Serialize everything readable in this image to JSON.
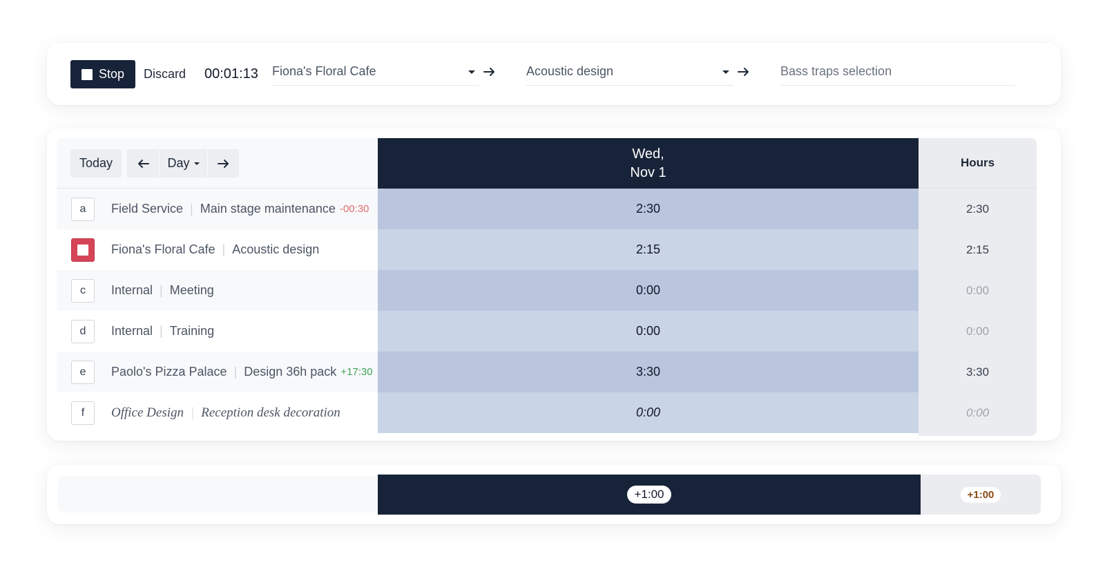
{
  "timer": {
    "stop_label": "Stop",
    "discard_label": "Discard",
    "elapsed": "00:01:13",
    "client": "Fiona's Floral Cafe",
    "project": "Acoustic design",
    "task_placeholder": "Bass traps selection"
  },
  "nav": {
    "today_label": "Today",
    "view_label": "Day"
  },
  "day_header": {
    "line1": "Wed,",
    "line2": "Nov 1"
  },
  "hours_header": "Hours",
  "rows": [
    {
      "key": "a",
      "client": "Field Service",
      "project": "Main stage maintenance",
      "badge": "-00:30",
      "day_value": "2:30",
      "total": "2:30"
    },
    {
      "key": "",
      "client": "Fiona's Floral Cafe",
      "project": "Acoustic design",
      "badge": "",
      "day_value": "2:15",
      "total": "2:15"
    },
    {
      "key": "c",
      "client": "Internal",
      "project": "Meeting",
      "badge": "",
      "day_value": "0:00",
      "total": "0:00"
    },
    {
      "key": "d",
      "client": "Internal",
      "project": "Training",
      "badge": "",
      "day_value": "0:00",
      "total": "0:00"
    },
    {
      "key": "e",
      "client": "Paolo's Pizza Palace",
      "project": "Design 36h pack",
      "badge": "+17:30",
      "day_value": "3:30",
      "total": "3:30"
    },
    {
      "key": "f",
      "client": "Office Design",
      "project": "Reception desk decoration",
      "badge": "",
      "day_value": "0:00",
      "total": "0:00"
    }
  ],
  "footer": {
    "day_diff": "+1:00",
    "total_diff": "+1:00"
  },
  "colors": {
    "navy": "#172338",
    "active_red": "#d64457",
    "negative": "#e06c6c",
    "positive": "#3fa35c"
  }
}
